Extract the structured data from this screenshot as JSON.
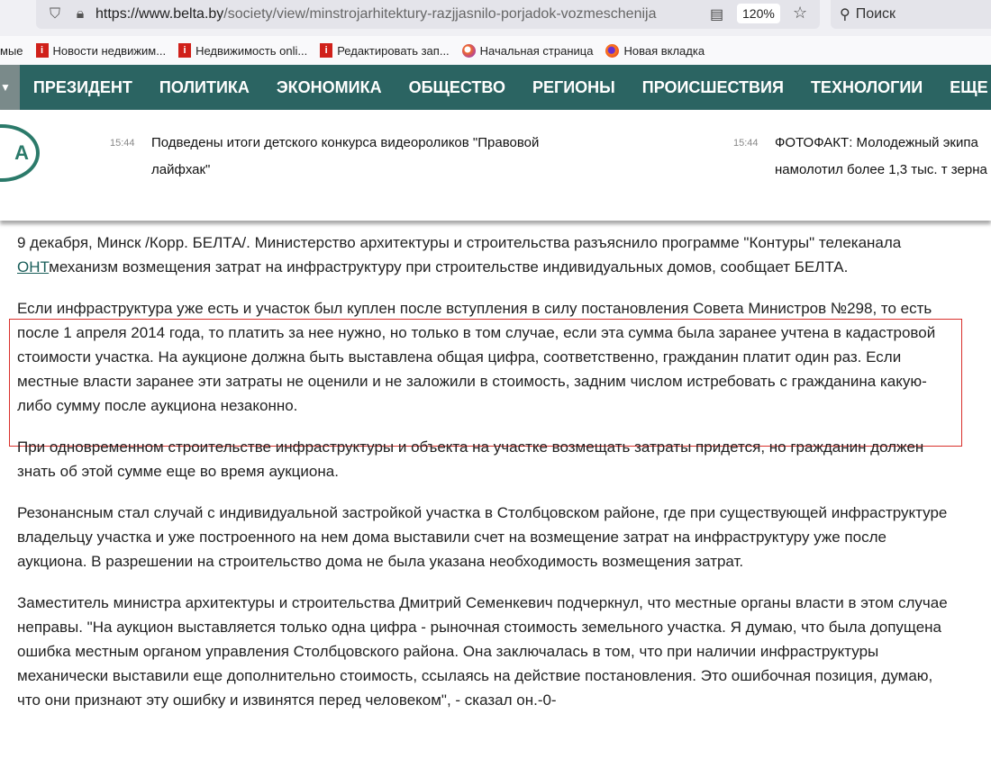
{
  "browser": {
    "url_domain": "https://www.belta.by",
    "url_path": "/society/view/minstrojarhitektury-razjjasnilo-porjadok-vozmeschenija",
    "zoom": "120%",
    "search_placeholder": "Поиск"
  },
  "bookmarks": [
    {
      "label": "мые"
    },
    {
      "label": "Новости недвижим..."
    },
    {
      "label": "Недвижимость onli..."
    },
    {
      "label": "Редактировать зап..."
    },
    {
      "label": "Начальная страница"
    },
    {
      "label": "Новая вкладка"
    }
  ],
  "nav": {
    "items": [
      "ПРЕЗИДЕНТ",
      "ПОЛИТИКА",
      "ЭКОНОМИКА",
      "ОБЩЕСТВО",
      "РЕГИОНЫ",
      "ПРОИСШЕСТВИЯ",
      "ТЕХНОЛОГИИ"
    ],
    "more": "ЕЩЕ"
  },
  "logo": {
    "text": "А"
  },
  "ticker": [
    {
      "time": "15:44",
      "title": "Подведены итоги детского конкурса видеороликов \"Правовой лайфхак\""
    },
    {
      "time": "15:44",
      "title": "ФОТОФАКТ: Молодежный экипа намолотил более 1,3 тыс. т зерна"
    }
  ],
  "article": {
    "p1_before": "9 декабря, Минск /Корр. БЕЛТА/. Министерство архитектуры и строительства разъяснило программе \"Контуры\" телеканала ",
    "p1_link": "ОНТ",
    "p1_after": "механизм возмещения затрат на инфраструктуру при строительстве индивидуальных домов, сообщает БЕЛТА.",
    "p2": "Если инфраструктура уже есть и участок был куплен после вступления в силу постановления Совета Министров №298, то есть после 1 апреля 2014 года, то платить за нее нужно, но только в том случае, если эта сумма была заранее учтена в кадастровой стоимости участка. На аукционе должна быть выставлена общая цифра, соответственно, гражданин платит один раз. Если местные власти заранее эти затраты не оценили и не заложили в стоимость, задним числом истребовать с гражданина какую-либо сумму после аукциона незаконно.",
    "p3": "При одновременном строительстве инфраструктуры и объекта на участке возмещать затраты придется, но гражданин должен знать об этой сумме еще во время аукциона.",
    "p4": "Резонансным стал случай с индивидуальной застройкой участка в Столбцовском районе, где при существующей инфраструктуре владельцу участка и уже построенного на нем дома выставили счет на возмещение затрат на инфраструктуру уже после аукциона. В разрешении на строительство дома не была указана необходимость возмещения затрат.",
    "p5": "Заместитель министра архитектуры и строительства Дмитрий Семенкевич подчеркнул, что местные органы власти в этом случае неправы. \"На аукцион выставляется только одна цифра - рыночная стоимость земельного участка. Я думаю, что была допущена ошибка местным органом управления Столбцовского района. Она заключалась в том, что при наличии инфраструктуры механически выставили еще дополнительно стоимость, ссылаясь на действие постановления. Это ошибочная позиция, думаю, что они признают эту ошибку и извинятся перед человеком\", - сказал он.-0-"
  }
}
